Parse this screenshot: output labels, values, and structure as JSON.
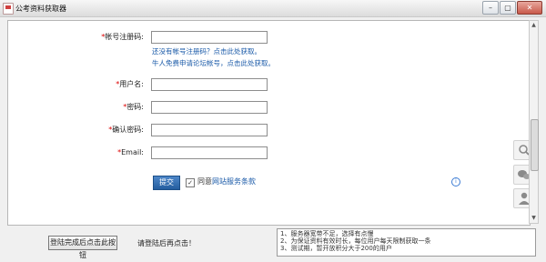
{
  "window": {
    "title": "公考资料获取器"
  },
  "form": {
    "account_label": "帐号注册码:",
    "hint1": "还没有帐号注册码？点击此处获取。",
    "hint2": "牛人免费申请论坛帐号，点击此处获取。",
    "username_label": "用户名:",
    "password_label": "密码:",
    "confirm_label": "确认密码:",
    "email_label": "Email:",
    "required_mark": "*",
    "submit_label": "提交",
    "agree_prefix": "同意",
    "agree_link": "网站服务条款",
    "agree_checked": true
  },
  "bottom": {
    "button_label": "登陆完成后点击此按钮",
    "text": "请登陆后再点击！",
    "notes": [
      "1、服务器宽带不足，选择有点慢",
      "2、为保证资料有效时长，每位用户每天限制获取一条",
      "3、测试期，暂开放积分大于200的用户"
    ]
  },
  "icons": [
    "search-icon",
    "wechat-icon",
    "user-icon",
    "info-icon"
  ]
}
